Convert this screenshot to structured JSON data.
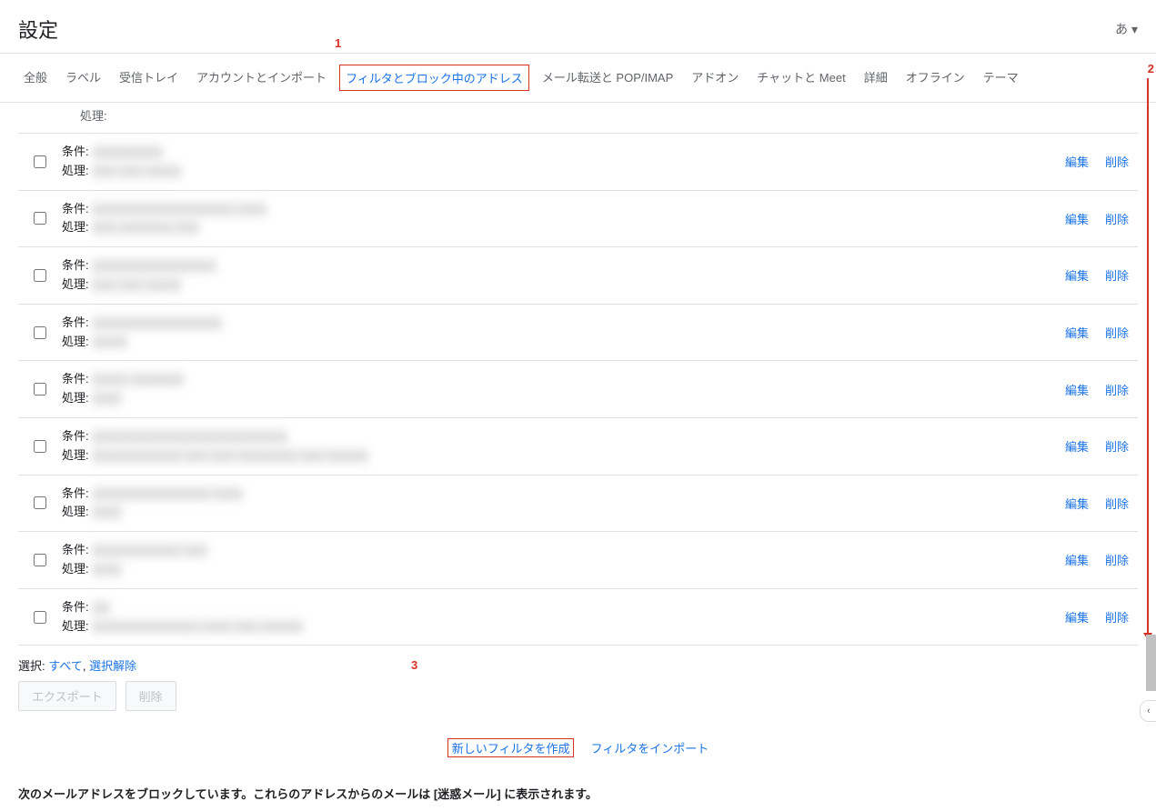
{
  "header": {
    "title": "設定",
    "lang_label": "あ"
  },
  "tabs": [
    {
      "label": "全般",
      "active": false
    },
    {
      "label": "ラベル",
      "active": false
    },
    {
      "label": "受信トレイ",
      "active": false
    },
    {
      "label": "アカウントとインポート",
      "active": false
    },
    {
      "label": "フィルタとブロック中のアドレス",
      "active": true
    },
    {
      "label": "メール転送と POP/IMAP",
      "active": false
    },
    {
      "label": "アドオン",
      "active": false
    },
    {
      "label": "チャットと Meet",
      "active": false
    },
    {
      "label": "詳細",
      "active": false
    },
    {
      "label": "オフライン",
      "active": false
    },
    {
      "label": "テーマ",
      "active": false
    }
  ],
  "partial_row": {
    "proc_label": "処理:"
  },
  "filter_labels": {
    "cond": "条件:",
    "proc": "処理:",
    "edit": "編集",
    "delete": "削除"
  },
  "filters": [
    {
      "cond_redacted": "xxxxxxxxxxxx",
      "proc_redacted": "xxxx xxxx xxxxxx"
    },
    {
      "cond_redacted": "xxxxxxxxxxxxxxxxxxxxxxxx xxxxx",
      "proc_redacted": "xxxx xxxxxxxxx xxxx"
    },
    {
      "cond_redacted": "xxxxxxxxxxxxxxxxxxxxx",
      "proc_redacted": "xxxx xxxx xxxxxx"
    },
    {
      "cond_redacted": "xxxxxxxxxxxxxxxxxxxxxx",
      "proc_redacted": "xxxxxx"
    },
    {
      "cond_redacted": "xxxxxx xxxxxxxxx",
      "proc_redacted": "xxxxx"
    },
    {
      "cond_redacted": "xxxxxxxxxxxxxxxxxxxxxxxxxxxxxxxxx",
      "proc_redacted": "xxxxxxxxxxxxxxx xxxx xxxx xxxxxxxxxx xxxx xxxxxxx"
    },
    {
      "cond_redacted": "xxxxxxxxxxxxxxxxxxxx xxxxx",
      "proc_redacted": "xxxxx"
    },
    {
      "cond_redacted": "xxxxxxxxxxxxxxx xxxx",
      "proc_redacted": "xxxxx"
    },
    {
      "cond_redacted": "xxx",
      "proc_redacted": "xxxxxxxxxxxxxxxxxx xxxxx xxxx xxxxxxx"
    }
  ],
  "selection": {
    "label": "選択:",
    "all": "すべて",
    "sep": ",",
    "none": "選択解除"
  },
  "bulk": {
    "export": "エクスポート",
    "delete": "削除"
  },
  "create": {
    "new_filter": "新しいフィルタを作成",
    "import_filter": "フィルタをインポート"
  },
  "blocked_heading": "次のメールアドレスをブロックしています。これらのアドレスからのメールは [迷惑メール] に表示されます。",
  "annotations": {
    "a1": "1",
    "a2": "2",
    "a3": "3"
  }
}
